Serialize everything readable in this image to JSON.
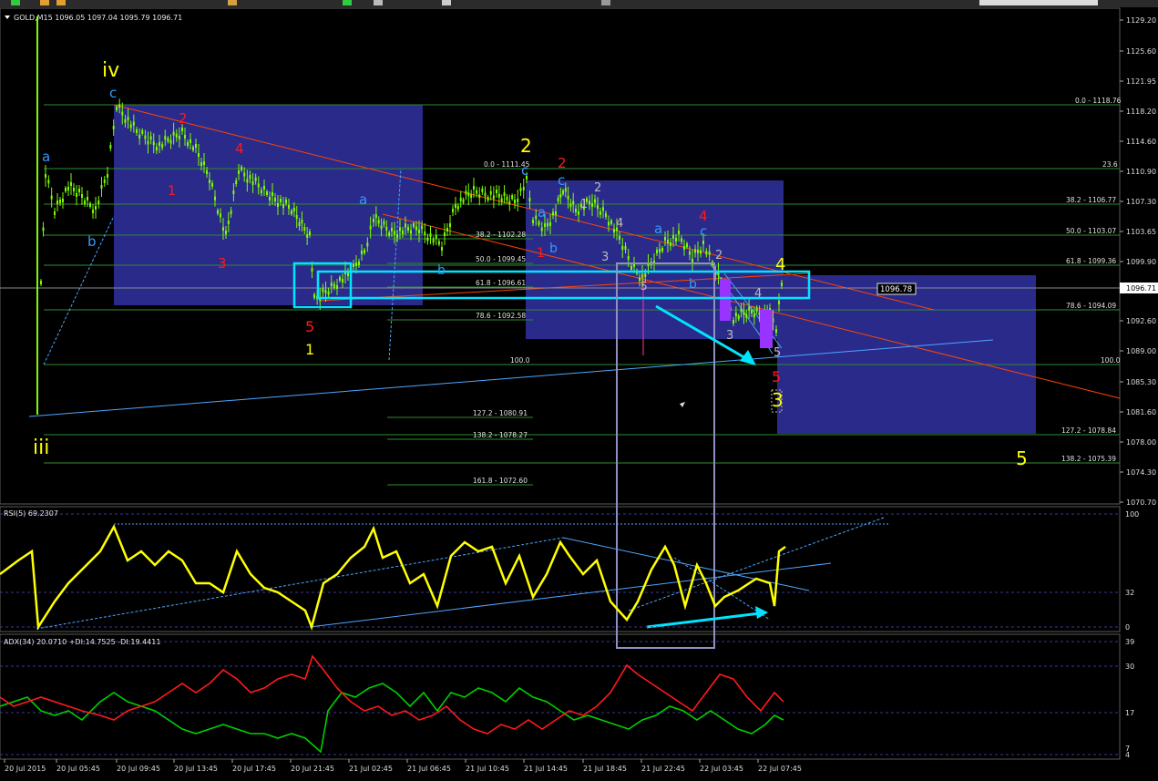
{
  "window": {
    "symbol_header": "GOLD,M15  1096.05 1097.04 1095.79 1096.71",
    "current_price_label": "1096.71",
    "marker_price_label": "1096.78"
  },
  "colors": {
    "background": "#000000",
    "grid": "#1f1f1f",
    "candles": "#7cfc00",
    "fib": "#2e8b2e",
    "box_fill": "#2a2a8a",
    "cyan": "#00e5ff",
    "trend_red": "#ff4500",
    "trend_blue": "#4da6ff",
    "rsi_line": "#ffff00",
    "adx_plus": "#00d000",
    "adx_minus": "#ff1a1a"
  },
  "price_axis": {
    "ticks": [
      "1129.20",
      "1125.60",
      "1121.95",
      "1118.20",
      "1114.60",
      "1110.90",
      "1107.30",
      "1103.65",
      "1099.90",
      "1096.25",
      "1092.60",
      "1089.00",
      "1085.30",
      "1081.60",
      "1078.00",
      "1074.30",
      "1070.70"
    ]
  },
  "time_axis": {
    "ticks": [
      "20 Jul 2015",
      "20 Jul 05:45",
      "20 Jul 09:45",
      "20 Jul 13:45",
      "20 Jul 17:45",
      "20 Jul 21:45",
      "21 Jul 02:45",
      "21 Jul 06:45",
      "21 Jul 10:45",
      "21 Jul 14:45",
      "21 Jul 18:45",
      "21 Jul 22:45",
      "22 Jul 03:45",
      "22 Jul 07:45"
    ]
  },
  "fib_levels": [
    "0.0 - 1118.76",
    "23.6",
    "38.2 - 1106.77",
    "50.0 - 1103.07",
    "61.8 - 1099.36",
    "78.6 - 1094.09",
    "100.0",
    "127.2 - 1078.84",
    "138.2 - 1075.39",
    "0.0 - 1111.45",
    "38.2 - 1102.28",
    "50.0 - 1099.45",
    "61.8 - 1096.61",
    "78.6 - 1092.58",
    "100.0",
    "127.2 - 1080.91",
    "138.2 - 1078.27",
    "161.8 - 1072.60"
  ],
  "wave_labels": [
    "iv",
    "iii",
    "c",
    "a",
    "b",
    "2",
    "1",
    "4",
    "3",
    "5",
    "1",
    "a",
    "b",
    "2",
    "c",
    "1",
    "2",
    "c",
    "a",
    "b",
    "1",
    "2",
    "3",
    "4",
    "a",
    "4",
    "c",
    "2",
    "b",
    "3",
    "4",
    "5",
    "4",
    "5",
    "3",
    "5",
    "5"
  ],
  "rsi": {
    "header": "RSI(5) 69.2307",
    "levels": [
      "100",
      "32",
      "0"
    ]
  },
  "adx": {
    "header": "ADX(34) 20.0710  +DI:14.7525  -DI:19.4411",
    "levels": [
      "39",
      "30",
      "17",
      "4",
      "7"
    ]
  }
}
